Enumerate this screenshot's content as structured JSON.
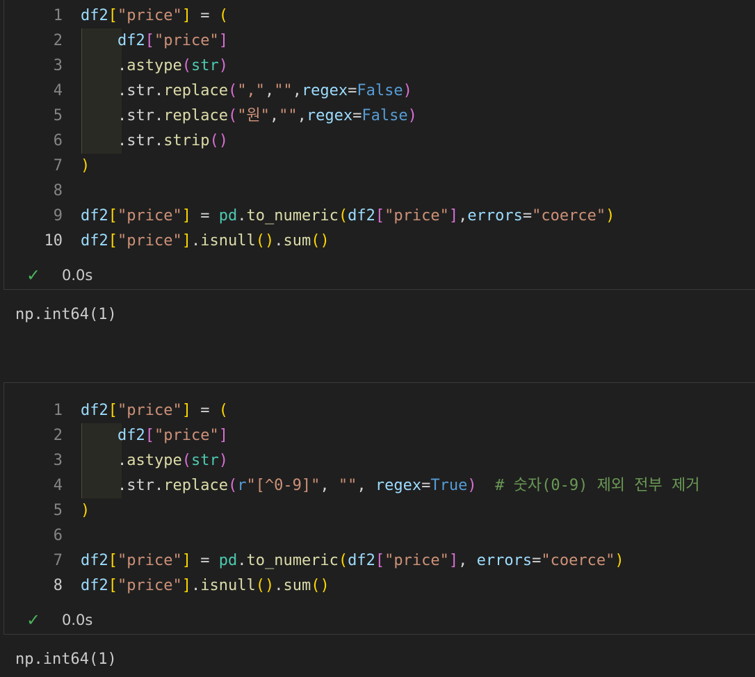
{
  "cell1": {
    "line_numbers": [
      "1",
      "2",
      "3",
      "4",
      "5",
      "6",
      "7",
      "8",
      "9",
      "10"
    ],
    "lines": [
      [
        [
          "v",
          "df2"
        ],
        [
          "b1",
          "["
        ],
        [
          "s",
          "\"price\""
        ],
        [
          "b1",
          "]"
        ],
        [
          "p",
          " = "
        ],
        [
          "b1",
          "("
        ]
      ],
      [
        [
          "p",
          "    "
        ],
        [
          "v",
          "df2"
        ],
        [
          "b2",
          "["
        ],
        [
          "s",
          "\"price\""
        ],
        [
          "b2",
          "]"
        ]
      ],
      [
        [
          "p",
          "    ."
        ],
        [
          "f",
          "astype"
        ],
        [
          "b2",
          "("
        ],
        [
          "t",
          "str"
        ],
        [
          "b2",
          ")"
        ]
      ],
      [
        [
          "p",
          "    .str."
        ],
        [
          "f",
          "replace"
        ],
        [
          "b2",
          "("
        ],
        [
          "s",
          "\",\""
        ],
        [
          "p",
          ","
        ],
        [
          "s",
          "\"\""
        ],
        [
          "p",
          ","
        ],
        [
          "kw",
          "regex"
        ],
        [
          "p",
          "="
        ],
        [
          "k",
          "False"
        ],
        [
          "b2",
          ")"
        ]
      ],
      [
        [
          "p",
          "    .str."
        ],
        [
          "f",
          "replace"
        ],
        [
          "b2",
          "("
        ],
        [
          "s",
          "\"원\""
        ],
        [
          "p",
          ","
        ],
        [
          "s",
          "\"\""
        ],
        [
          "p",
          ","
        ],
        [
          "kw",
          "regex"
        ],
        [
          "p",
          "="
        ],
        [
          "k",
          "False"
        ],
        [
          "b2",
          ")"
        ]
      ],
      [
        [
          "p",
          "    .str."
        ],
        [
          "f",
          "strip"
        ],
        [
          "b2",
          "()"
        ]
      ],
      [
        [
          "b1",
          ")"
        ]
      ],
      [],
      [
        [
          "v",
          "df2"
        ],
        [
          "b1",
          "["
        ],
        [
          "s",
          "\"price\""
        ],
        [
          "b1",
          "]"
        ],
        [
          "p",
          " = "
        ],
        [
          "t",
          "pd"
        ],
        [
          "p",
          "."
        ],
        [
          "f",
          "to_numeric"
        ],
        [
          "b1",
          "("
        ],
        [
          "v",
          "df2"
        ],
        [
          "b2",
          "["
        ],
        [
          "s",
          "\"price\""
        ],
        [
          "b2",
          "]"
        ],
        [
          "p",
          ","
        ],
        [
          "kw",
          "errors"
        ],
        [
          "p",
          "="
        ],
        [
          "s",
          "\"coerce\""
        ],
        [
          "b1",
          ")"
        ]
      ],
      [
        [
          "v",
          "df2"
        ],
        [
          "b1",
          "["
        ],
        [
          "s",
          "\"price\""
        ],
        [
          "b1",
          "]"
        ],
        [
          "p",
          "."
        ],
        [
          "f",
          "isnull"
        ],
        [
          "b1",
          "()"
        ],
        [
          "p",
          "."
        ],
        [
          "f",
          "sum"
        ],
        [
          "b1",
          "()"
        ]
      ]
    ],
    "active_line": 10,
    "status_time": "0.0s",
    "output": "np.int64(1)"
  },
  "cell2": {
    "line_numbers": [
      "1",
      "2",
      "3",
      "4",
      "5",
      "6",
      "7",
      "8"
    ],
    "lines": [
      [
        [
          "v",
          "df2"
        ],
        [
          "b1",
          "["
        ],
        [
          "s",
          "\"price\""
        ],
        [
          "b1",
          "]"
        ],
        [
          "p",
          " = "
        ],
        [
          "b1",
          "("
        ]
      ],
      [
        [
          "p",
          "    "
        ],
        [
          "v",
          "df2"
        ],
        [
          "b2",
          "["
        ],
        [
          "s",
          "\"price\""
        ],
        [
          "b2",
          "]"
        ]
      ],
      [
        [
          "p",
          "    ."
        ],
        [
          "f",
          "astype"
        ],
        [
          "b2",
          "("
        ],
        [
          "t",
          "str"
        ],
        [
          "b2",
          ")"
        ]
      ],
      [
        [
          "p",
          "    .str."
        ],
        [
          "f",
          "replace"
        ],
        [
          "b2",
          "("
        ],
        [
          "k",
          "r"
        ],
        [
          "s",
          "\"[^0-9]\""
        ],
        [
          "p",
          ", "
        ],
        [
          "s",
          "\"\""
        ],
        [
          "p",
          ", "
        ],
        [
          "kw",
          "regex"
        ],
        [
          "p",
          "="
        ],
        [
          "k",
          "True"
        ],
        [
          "b2",
          ")"
        ],
        [
          "p",
          "  "
        ],
        [
          "c",
          "# 숫자(0-9) 제외 전부 제거"
        ]
      ],
      [
        [
          "b1",
          ")"
        ]
      ],
      [],
      [
        [
          "v",
          "df2"
        ],
        [
          "b1",
          "["
        ],
        [
          "s",
          "\"price\""
        ],
        [
          "b1",
          "]"
        ],
        [
          "p",
          " = "
        ],
        [
          "t",
          "pd"
        ],
        [
          "p",
          "."
        ],
        [
          "f",
          "to_numeric"
        ],
        [
          "b1",
          "("
        ],
        [
          "v",
          "df2"
        ],
        [
          "b2",
          "["
        ],
        [
          "s",
          "\"price\""
        ],
        [
          "b2",
          "]"
        ],
        [
          "p",
          ", "
        ],
        [
          "kw",
          "errors"
        ],
        [
          "p",
          "="
        ],
        [
          "s",
          "\"coerce\""
        ],
        [
          "b1",
          ")"
        ]
      ],
      [
        [
          "v",
          "df2"
        ],
        [
          "b1",
          "["
        ],
        [
          "s",
          "\"price\""
        ],
        [
          "b1",
          "]"
        ],
        [
          "p",
          "."
        ],
        [
          "f",
          "isnull"
        ],
        [
          "b1",
          "()"
        ],
        [
          "p",
          "."
        ],
        [
          "f",
          "sum"
        ],
        [
          "b1",
          "()"
        ]
      ]
    ],
    "active_line": 8,
    "status_time": "0.0s",
    "output": "np.int64(1)"
  },
  "icons": {
    "status_check": "checkmark-icon"
  },
  "colors": {
    "background": "#1f1f1f",
    "success": "#4bb35c"
  }
}
